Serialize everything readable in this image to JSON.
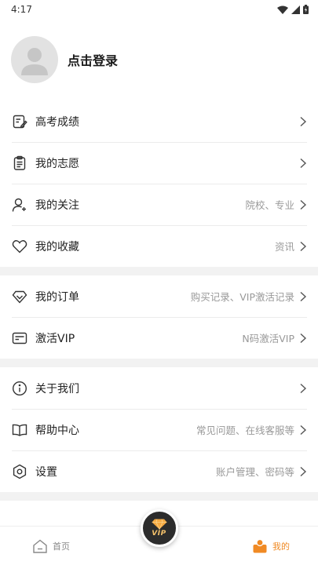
{
  "status_bar": {
    "time": "4:17"
  },
  "profile": {
    "login_label": "点击登录"
  },
  "groups": [
    {
      "items": [
        {
          "label": "高考成绩",
          "sub": "",
          "icon": "exam-score-icon"
        },
        {
          "label": "我的志愿",
          "sub": "",
          "icon": "clipboard-icon"
        },
        {
          "label": "我的关注",
          "sub": "院校、专业",
          "icon": "user-follow-icon"
        },
        {
          "label": "我的收藏",
          "sub": "资讯",
          "icon": "heart-icon"
        }
      ]
    },
    {
      "items": [
        {
          "label": "我的订单",
          "sub": "购买记录、VIP激活记录",
          "icon": "diamond-icon"
        },
        {
          "label": "激活VIP",
          "sub": "N码激活VIP",
          "icon": "card-icon"
        }
      ]
    },
    {
      "items": [
        {
          "label": "关于我们",
          "sub": "",
          "icon": "info-icon"
        },
        {
          "label": "帮助中心",
          "sub": "常见问题、在线客服等",
          "icon": "book-icon"
        },
        {
          "label": "设置",
          "sub": "账户管理、密码等",
          "icon": "settings-icon"
        }
      ]
    }
  ],
  "tabbar": {
    "home_label": "首页",
    "vip_label": "VIP",
    "mine_label": "我的"
  },
  "colors": {
    "accent": "#f08a24",
    "vip_gold": "#f5c26b",
    "divider": "#f2f2f2"
  }
}
